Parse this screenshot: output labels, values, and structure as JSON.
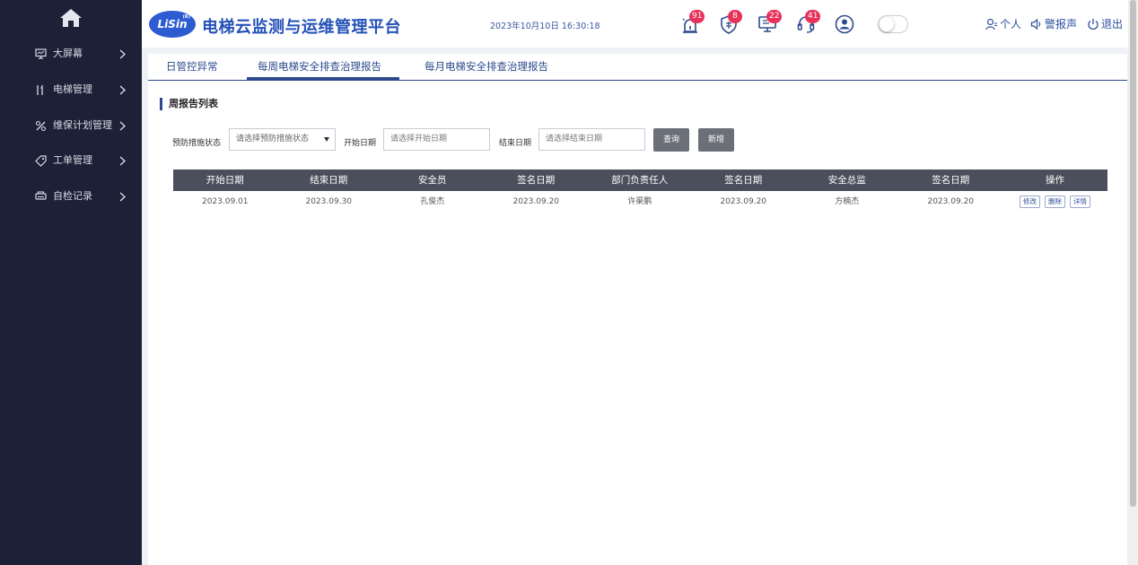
{
  "sidebar": {
    "home_icon": "home-icon",
    "items": [
      {
        "label": "大屏幕",
        "icon": "monitor-icon"
      },
      {
        "label": "电梯管理",
        "icon": "elevator-icon"
      },
      {
        "label": "维保计划管理",
        "icon": "tools-icon"
      },
      {
        "label": "工单管理",
        "icon": "tag-icon"
      },
      {
        "label": "自检记录",
        "icon": "printer-icon"
      }
    ]
  },
  "header": {
    "logo_text": "LiSin",
    "logo_reg": "(R)",
    "title": "电梯云监测与运维管理平台",
    "datetime": "2023年10月10日 16:30:18",
    "badges": {
      "alarm": "91",
      "shield": "8",
      "monitor": "22",
      "service": "41"
    },
    "links": {
      "personal": "个人",
      "alarm_sound": "警报声",
      "logout": "退出"
    }
  },
  "tabs": [
    {
      "label": "日管控异常"
    },
    {
      "label": "每周电梯安全排查治理报告"
    },
    {
      "label": "每月电梯安全排查治理报告"
    }
  ],
  "section_title": "周报告列表",
  "filters": {
    "status_label": "预防措施状态",
    "status_placeholder": "请选择预防措施状态",
    "start_label": "开始日期",
    "start_placeholder": "请选择开始日期",
    "end_label": "结束日期",
    "end_placeholder": "请选择结束日期",
    "query_button": "查询",
    "add_button": "新增"
  },
  "table": {
    "columns": [
      "开始日期",
      "结束日期",
      "安全员",
      "签名日期",
      "部门负责任人",
      "签名日期",
      "安全总监",
      "签名日期",
      "操作"
    ],
    "rows": [
      {
        "cells": [
          "2023.09.01",
          "2023.09.30",
          "孔俊杰",
          "2023.09.20",
          "许渠鹏",
          "2023.09.20",
          "方楠杰",
          "2023.09.20"
        ],
        "actions": [
          "修改",
          "删除",
          "详情"
        ]
      }
    ]
  },
  "colors": {
    "sidebar_bg": "#1c2137",
    "brand": "#2351b8",
    "accent": "#2c4a8c",
    "badge": "#e8325a",
    "table_header": "#4b4e5b"
  }
}
